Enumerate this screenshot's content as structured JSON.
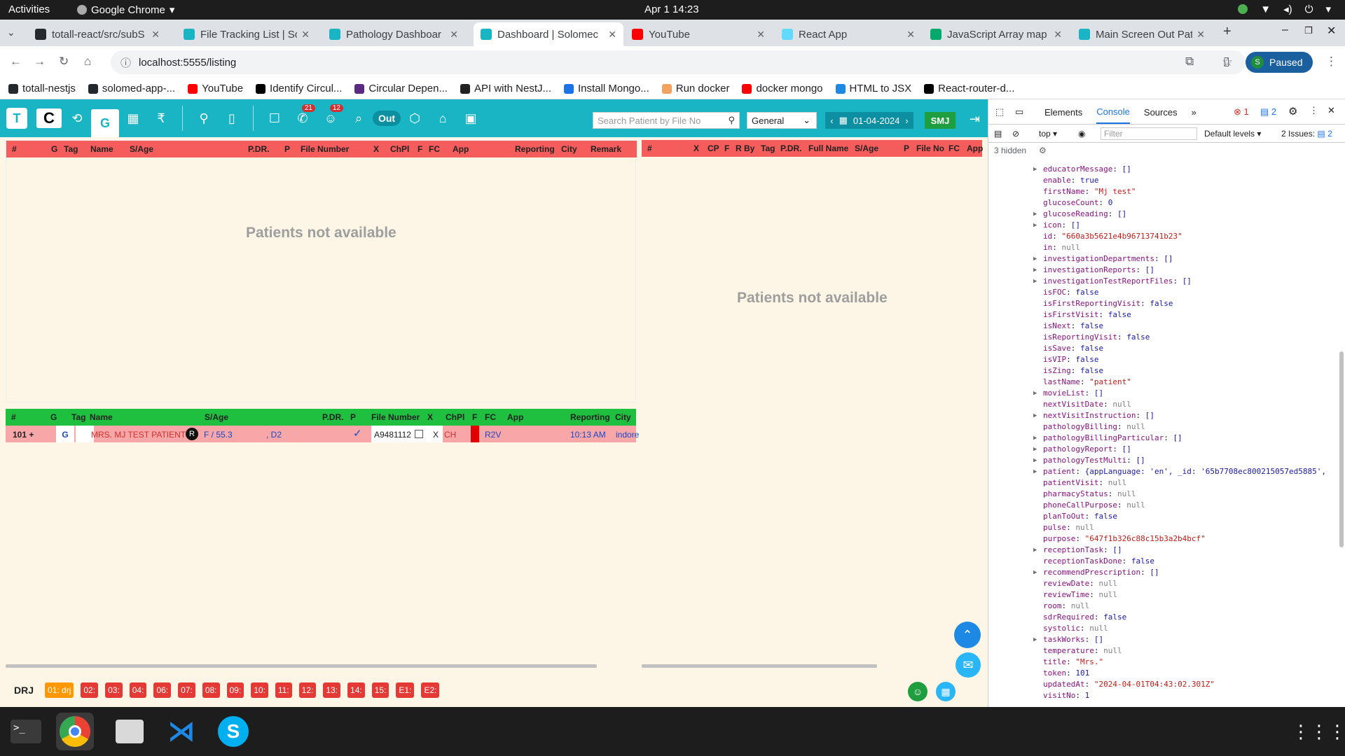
{
  "os": {
    "activities": "Activities",
    "app_name": "Google Chrome",
    "clock": "Apr 1  14:23"
  },
  "tabs": [
    {
      "label": "totall-react/src/subS",
      "icon": "github-icon",
      "color": "#24292e"
    },
    {
      "label": "File Tracking List | So",
      "icon": "app-icon",
      "color": "#1ab5c5"
    },
    {
      "label": "Pathology Dashboar",
      "icon": "app-icon",
      "color": "#1ab5c5"
    },
    {
      "label": "Dashboard | Solomec",
      "icon": "app-icon",
      "color": "#1ab5c5",
      "active": true
    },
    {
      "label": "YouTube",
      "icon": "youtube-icon",
      "color": "#ff0000"
    },
    {
      "label": "React App",
      "icon": "react-icon",
      "color": "#61dafb"
    },
    {
      "label": "JavaScript Array map",
      "icon": "w3-icon",
      "color": "#04aa6d"
    },
    {
      "label": "Main Screen Out Pat",
      "icon": "app-icon",
      "color": "#1ab5c5"
    }
  ],
  "url": "localhost:5555/listing",
  "profile": {
    "initial": "S",
    "label": "Paused"
  },
  "bookmarks": [
    {
      "label": "totall-nestjs",
      "color": "#24292e"
    },
    {
      "label": "solomed-app-...",
      "color": "#24292e"
    },
    {
      "label": "YouTube",
      "color": "#ff0000"
    },
    {
      "label": "Identify Circul...",
      "color": "#000000"
    },
    {
      "label": "Circular Depen...",
      "color": "#5b2b82"
    },
    {
      "label": "API with NestJ...",
      "color": "#222222"
    },
    {
      "label": "Install Mongo...",
      "color": "#1a73e8"
    },
    {
      "label": "Run docker",
      "color": "#f4a261"
    },
    {
      "label": "docker mongo",
      "color": "#ff0000"
    },
    {
      "label": "HTML to JSX",
      "color": "#1e88e5"
    },
    {
      "label": "React-router-d...",
      "color": "#000000"
    }
  ],
  "toolbar": {
    "g_label": "G",
    "badge_calls": "21",
    "badge_people": "12",
    "out_label": "Out",
    "search_placeholder": "Search Patient by File No",
    "select_value": "General",
    "date": "01-04-2024",
    "smj_label": "SMJ"
  },
  "top_left_headers": [
    "#",
    "G",
    "Tag",
    "Name",
    "S/Age",
    "P.DR.",
    "P",
    "File Number",
    "X",
    "ChPl",
    "F",
    "FC",
    "App",
    "Reporting",
    "City",
    "Remark"
  ],
  "top_right_headers": [
    "#",
    "X",
    "CP",
    "F",
    "R By",
    "Tag",
    "P.DR.",
    "Full Name",
    "S/Age",
    "P",
    "File No",
    "FC",
    "App"
  ],
  "bottom_headers": [
    "#",
    "G",
    "Tag",
    "Name",
    "S/Age",
    "P.DR.",
    "P",
    "File Number",
    "X",
    "ChPl",
    "F",
    "FC",
    "App",
    "Reporting",
    "City"
  ],
  "empty_message": "Patients not available",
  "patient_row": {
    "num": "101 +",
    "g": "G",
    "name": "MRS. MJ TEST PATIENT",
    "name_badge": "R",
    "sage": "F / 55.3",
    "pdr": ", D2",
    "file": "A9481112",
    "x": "X",
    "chpl": "CH",
    "fc": "R2V",
    "reporting": "10:13 AM",
    "city": "indore"
  },
  "bottom_label": "DRJ",
  "chips": [
    "01: drj",
    "02:",
    "03:",
    "04:",
    "06:",
    "07:",
    "08:",
    "09:",
    "10:",
    "11:",
    "12:",
    "13:",
    "14:",
    "15:",
    "E1:",
    "E2:"
  ],
  "devtools": {
    "tabs": [
      "Elements",
      "Console",
      "Sources"
    ],
    "active_tab": "Console",
    "errors": "1",
    "messages": "2",
    "context": "top",
    "filter_placeholder": "Filter",
    "levels": "Default levels",
    "issues": "2 Issues:",
    "issues_count": "2",
    "hidden": "3 hidden",
    "props": [
      {
        "k": "educatorMessage",
        "v": "[]",
        "t": "arr",
        "exp": true
      },
      {
        "k": "enable",
        "v": "true",
        "t": "kw"
      },
      {
        "k": "firstName",
        "v": "\"Mj test\"",
        "t": "str"
      },
      {
        "k": "glucoseCount",
        "v": "0",
        "t": "kw"
      },
      {
        "k": "glucoseReading",
        "v": "[]",
        "t": "arr",
        "exp": true
      },
      {
        "k": "icon",
        "v": "[]",
        "t": "arr",
        "exp": true
      },
      {
        "k": "id",
        "v": "\"660a3b5621e4b96713741b23\"",
        "t": "str"
      },
      {
        "k": "in",
        "v": "null",
        "t": "nul"
      },
      {
        "k": "investigationDepartments",
        "v": "[]",
        "t": "arr",
        "exp": true
      },
      {
        "k": "investigationReports",
        "v": "[]",
        "t": "arr",
        "exp": true
      },
      {
        "k": "investigationTestReportFiles",
        "v": "[]",
        "t": "arr",
        "exp": true
      },
      {
        "k": "isFOC",
        "v": "false",
        "t": "kw"
      },
      {
        "k": "isFirstReportingVisit",
        "v": "false",
        "t": "kw"
      },
      {
        "k": "isFirstVisit",
        "v": "false",
        "t": "kw"
      },
      {
        "k": "isNext",
        "v": "false",
        "t": "kw"
      },
      {
        "k": "isReportingVisit",
        "v": "false",
        "t": "kw"
      },
      {
        "k": "isSave",
        "v": "false",
        "t": "kw"
      },
      {
        "k": "isVIP",
        "v": "false",
        "t": "kw"
      },
      {
        "k": "isZing",
        "v": "false",
        "t": "kw"
      },
      {
        "k": "lastName",
        "v": "\"patient\"",
        "t": "str"
      },
      {
        "k": "movieList",
        "v": "[]",
        "t": "arr",
        "exp": true
      },
      {
        "k": "nextVisitDate",
        "v": "null",
        "t": "nul"
      },
      {
        "k": "nextVisitInstruction",
        "v": "[]",
        "t": "arr",
        "exp": true
      },
      {
        "k": "pathologyBilling",
        "v": "null",
        "t": "nul"
      },
      {
        "k": "pathologyBillingParticular",
        "v": "[]",
        "t": "arr",
        "exp": true
      },
      {
        "k": "pathologyReport",
        "v": "[]",
        "t": "arr",
        "exp": true
      },
      {
        "k": "pathologyTestMulti",
        "v": "[]",
        "t": "arr",
        "exp": true
      },
      {
        "k": "patient",
        "v": "{appLanguage: 'en', _id: '65b7708ec800215057ed5885',",
        "t": "obj",
        "exp": true
      },
      {
        "k": "patientVisit",
        "v": "null",
        "t": "nul"
      },
      {
        "k": "pharmacyStatus",
        "v": "null",
        "t": "nul"
      },
      {
        "k": "phoneCallPurpose",
        "v": "null",
        "t": "nul"
      },
      {
        "k": "planToOut",
        "v": "false",
        "t": "kw"
      },
      {
        "k": "pulse",
        "v": "null",
        "t": "nul"
      },
      {
        "k": "purpose",
        "v": "\"647f1b326c88c15b3a2b4bcf\"",
        "t": "str"
      },
      {
        "k": "receptionTask",
        "v": "[]",
        "t": "arr",
        "exp": true
      },
      {
        "k": "receptionTaskDone",
        "v": "false",
        "t": "kw"
      },
      {
        "k": "recommendPrescription",
        "v": "[]",
        "t": "arr",
        "exp": true
      },
      {
        "k": "reviewDate",
        "v": "null",
        "t": "nul"
      },
      {
        "k": "reviewTime",
        "v": "null",
        "t": "nul"
      },
      {
        "k": "room",
        "v": "null",
        "t": "nul"
      },
      {
        "k": "sdrRequired",
        "v": "false",
        "t": "kw"
      },
      {
        "k": "systolic",
        "v": "null",
        "t": "nul"
      },
      {
        "k": "taskWorks",
        "v": "[]",
        "t": "arr",
        "exp": true
      },
      {
        "k": "temperature",
        "v": "null",
        "t": "nul"
      },
      {
        "k": "title",
        "v": "\"Mrs.\"",
        "t": "str"
      },
      {
        "k": "token",
        "v": "101",
        "t": "kw"
      },
      {
        "k": "updatedAt",
        "v": "\"2024-04-01T04:43:02.301Z\"",
        "t": "str"
      },
      {
        "k": "visitNo",
        "v": "1",
        "t": "kw"
      }
    ]
  }
}
